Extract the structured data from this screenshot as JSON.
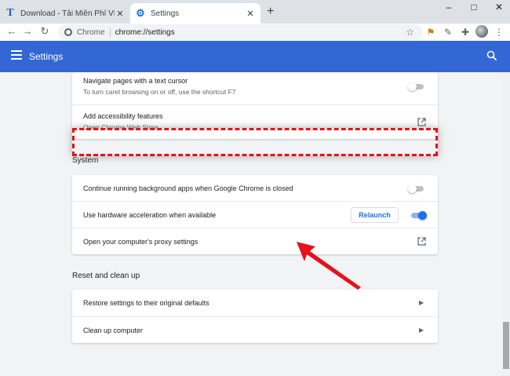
{
  "browser": {
    "tabs": [
      {
        "title": "Download - Tải Miễn Phí VN - Ph",
        "favicon": "T",
        "close": "✕"
      },
      {
        "title": "Settings",
        "favicon": "⚙",
        "close": "✕"
      }
    ],
    "new_tab": "+",
    "window_controls": {
      "minimize": "–",
      "maximize": "□",
      "close": "✕"
    },
    "nav": {
      "back": "←",
      "forward": "→",
      "reload": "↻"
    },
    "omnibox": {
      "chip": "Chrome",
      "url": "chrome://settings"
    },
    "toolbar_icons": [
      "star-icon",
      "extension-icon",
      "eyedropper-icon",
      "puzzle-icon",
      "avatar",
      "menu-icon"
    ]
  },
  "header": {
    "title": "Settings"
  },
  "accessibility": {
    "rows": [
      {
        "title": "Navigate pages with a text cursor",
        "subtitle": "To turn caret browsing on or off, use the shortcut F7",
        "toggle": "off"
      },
      {
        "title": "Add accessibility features",
        "subtitle": "Open Chrome Web Store"
      }
    ]
  },
  "system": {
    "title": "System",
    "rows": [
      {
        "title": "Continue running background apps when Google Chrome is closed",
        "toggle": "off"
      },
      {
        "title": "Use hardware acceleration when available",
        "button": "Relaunch",
        "toggle": "on"
      },
      {
        "title": "Open your computer's proxy settings"
      }
    ]
  },
  "reset": {
    "title": "Reset and clean up",
    "rows": [
      {
        "title": "Restore settings to their original defaults"
      },
      {
        "title": "Clean up computer"
      }
    ]
  },
  "colors": {
    "header": "#3367d6",
    "accent": "#1a73e8",
    "highlight": "#e8101a"
  }
}
